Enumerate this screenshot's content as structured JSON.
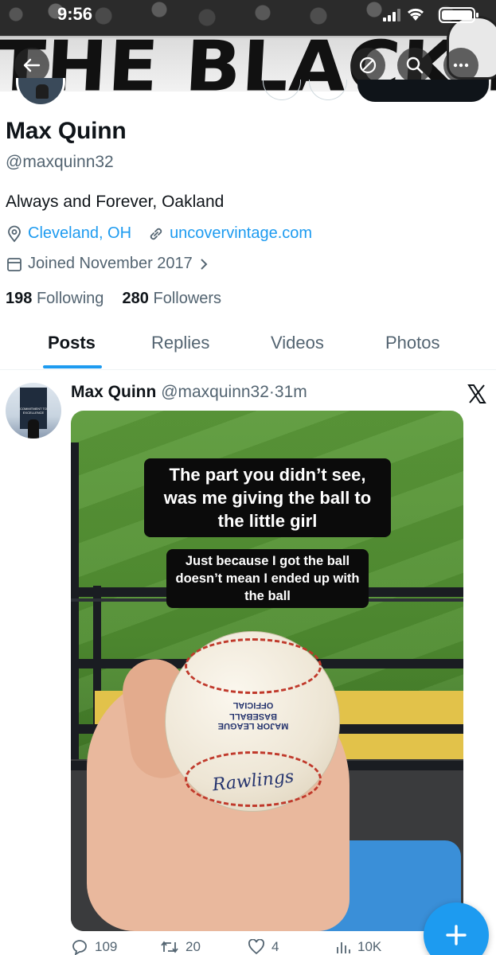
{
  "status_bar": {
    "time": "9:56"
  },
  "banner": {
    "text": "THE BLACK HOLE"
  },
  "profile": {
    "name": "Max Quinn",
    "handle": "@maxquinn32",
    "bio": "Always and Forever, Oakland",
    "location": "Cleveland, OH",
    "website": "uncovervintage.com",
    "joined": "Joined November 2017",
    "following_count": "198",
    "following_label": "Following",
    "followers_count": "280",
    "followers_label": "Followers"
  },
  "tabs": [
    {
      "label": "Posts",
      "active": true
    },
    {
      "label": "Replies",
      "active": false
    },
    {
      "label": "Videos",
      "active": false
    },
    {
      "label": "Photos",
      "active": false
    }
  ],
  "post": {
    "author_name": "Max Quinn",
    "author_handle": "@maxquinn32",
    "separator": "·",
    "time_ago": "31m",
    "avatar_text": "COMMITMENT TO EXCELLENCE",
    "media": {
      "caption_main": "The part you didn’t see, was me giving the ball to the little girl",
      "caption_sub": "Just because I got the ball doesn’t mean I ended up with the ball",
      "ball_text_1": "OFFICIAL",
      "ball_text_2": "MAJOR LEAGUE BASEBALL",
      "ball_brand": "Rawlings"
    },
    "stats": {
      "replies": "109",
      "reposts": "20",
      "likes": "4",
      "views": "10K"
    }
  },
  "icons": {
    "back": "back-arrow-icon",
    "mute": "mute-icon",
    "search": "search-icon",
    "more": "more-icon",
    "location": "location-pin-icon",
    "link": "link-icon",
    "calendar": "calendar-icon",
    "chevron": "chevron-right-icon",
    "x_logo": "x-logo-icon",
    "reply": "reply-icon",
    "repost": "repost-icon",
    "like": "like-icon",
    "views": "views-icon",
    "compose": "compose-plus-icon"
  },
  "colors": {
    "accent": "#1d9bf0",
    "text_primary": "#0f1419",
    "text_secondary": "#536471"
  }
}
